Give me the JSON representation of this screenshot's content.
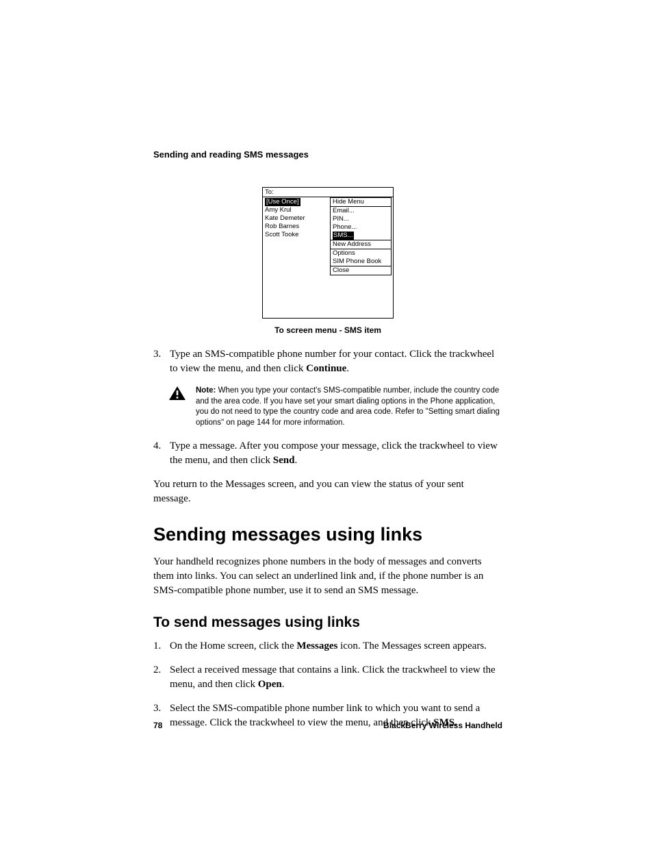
{
  "header": {
    "section_title": "Sending and reading SMS messages"
  },
  "screenshot": {
    "to_label": "To:",
    "use_once": "[Use Once]",
    "contacts": [
      "Amy Krul",
      "Kate Demeter",
      "Rob Barnes",
      "Scott Tooke"
    ],
    "menu_header": "Hide Menu",
    "group1": [
      "Email...",
      "PIN...",
      "Phone..."
    ],
    "sms_selected": "SMS...",
    "group2": [
      "New Address"
    ],
    "group3": [
      "Options",
      "SIM Phone Book"
    ],
    "group4": [
      "Close"
    ]
  },
  "caption": "To screen menu - SMS item",
  "step3": {
    "num": "3.",
    "text_a": "Type an SMS-compatible phone number for your contact. Click the trackwheel to view the menu, and then click ",
    "bold": "Continue",
    "text_b": "."
  },
  "note": {
    "bold": "Note:",
    "text": " When you type your contact's SMS-compatible number, include the country code and the area code. If you have set your smart dialing options in the Phone application, you do not need to type the country code and area code. Refer to \"Setting smart dialing options\" on page 144 for more information."
  },
  "step4": {
    "num": "4.",
    "text_a": "Type a message. After you compose your message, click the trackwheel to view the menu, and then click ",
    "bold": "Send",
    "text_b": "."
  },
  "return_para": "You return to the Messages screen, and you can view the status of your sent message.",
  "h1": "Sending messages using links",
  "intro_para": "Your handheld recognizes phone numbers in the body of messages and converts them into links. You can select an underlined link and, if the phone number is an SMS-compatible phone number, use it to send an SMS message.",
  "h2": "To send messages using links",
  "link_step1": {
    "num": "1.",
    "text_a": "On the Home screen, click the ",
    "bold": "Messages",
    "text_b": " icon. The Messages screen appears."
  },
  "link_step2": {
    "num": "2.",
    "text_a": "Select a received message that contains a link. Click the trackwheel to view the menu, and then click ",
    "bold": "Open",
    "text_b": "."
  },
  "link_step3": {
    "num": "3.",
    "text_a": "Select the SMS-compatible phone number link to which you want to send a message. Click the trackwheel to view the menu, and then click ",
    "bold": "SMS",
    "text_b": "."
  },
  "footer": {
    "page": "78",
    "product": "BlackBerry Wireless Handheld"
  }
}
